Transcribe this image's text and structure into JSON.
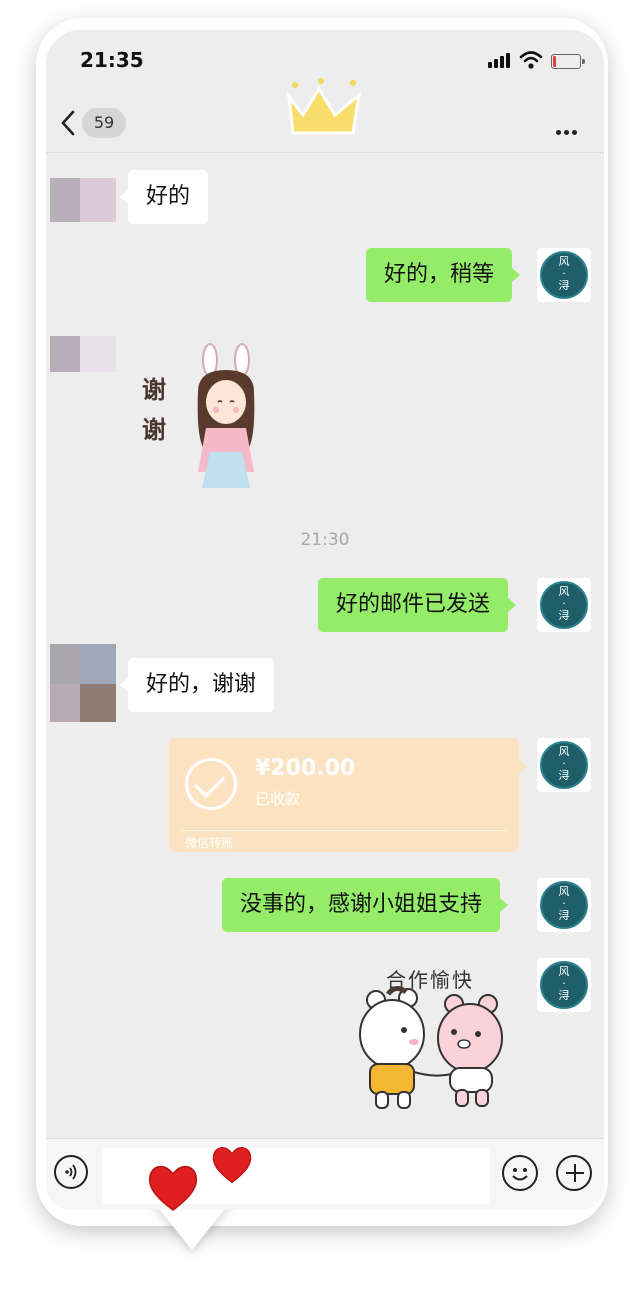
{
  "status_bar": {
    "time": "21:35"
  },
  "header": {
    "unread_count": "59"
  },
  "messages": [
    {
      "side": "in",
      "text": "好的"
    },
    {
      "side": "out",
      "text": "好的，稍等"
    },
    {
      "side": "in",
      "sticker_text": "谢谢"
    },
    {
      "side": "out",
      "text": "好的邮件已发送"
    },
    {
      "side": "in",
      "text": "好的，谢谢"
    },
    {
      "side": "out",
      "text": "没事的，感谢小姐姐支持"
    },
    {
      "side": "out",
      "sticker_text": "合作愉快"
    }
  ],
  "timestamp": "21:30",
  "transfer": {
    "amount": "¥200.00",
    "status": "已收款",
    "brand": "微信转账"
  },
  "sender_avatar": {
    "text_top": "风",
    "text_bottom": "浔"
  },
  "colors": {
    "sent_bubble": "#95ec69",
    "received_bubble": "#ffffff",
    "chat_background": "#ededed",
    "transfer_card": "#fbe3c1",
    "avatar_teal": "#1f5f6a",
    "crown": "#f5d75a",
    "heart": "#e02020"
  },
  "icons": {
    "back": "chevron-left-icon",
    "more": "more-dots-icon",
    "voice": "voice-icon",
    "emoji": "emoji-icon",
    "plus": "plus-icon"
  }
}
